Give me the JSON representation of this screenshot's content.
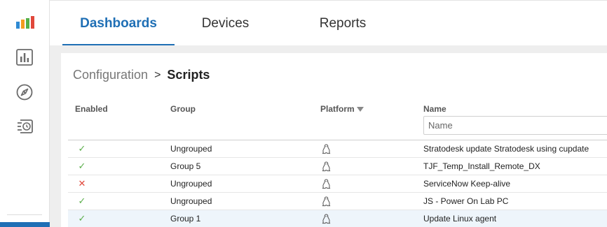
{
  "colors": {
    "accent": "#1f6fb5",
    "enabled_check": "#5aae4a",
    "disabled_x": "#e0483b",
    "logo_bars": [
      "#2f8ad3",
      "#f39c1f",
      "#55b048",
      "#e0483b"
    ]
  },
  "sidebar": {
    "icons": [
      "analytics-icon",
      "compass-icon",
      "scheduled-list-icon"
    ]
  },
  "tabs": [
    {
      "label": "Dashboards",
      "active": true
    },
    {
      "label": "Devices",
      "active": false
    },
    {
      "label": "Reports",
      "active": false
    }
  ],
  "breadcrumb": {
    "parent": "Configuration",
    "separator": ">",
    "current": "Scripts"
  },
  "table": {
    "headers": {
      "enabled": "Enabled",
      "group": "Group",
      "platform": "Platform",
      "name": "Name"
    },
    "name_filter_placeholder": "Name",
    "rows": [
      {
        "enabled": "✓",
        "enabled_state": "ok",
        "group": "Ungrouped",
        "platform": "linux-icon",
        "name": "Stratodesk update Stratodesk using cupdate"
      },
      {
        "enabled": "✓",
        "enabled_state": "ok",
        "group": "Group 5",
        "platform": "linux-icon",
        "name": "TJF_Temp_Install_Remote_DX"
      },
      {
        "enabled": "✕",
        "enabled_state": "fail",
        "group": "Ungrouped",
        "platform": "linux-icon",
        "name": "ServiceNow Keep-alive"
      },
      {
        "enabled": "✓",
        "enabled_state": "ok",
        "group": "Ungrouped",
        "platform": "linux-icon",
        "name": "JS - Power On Lab PC"
      },
      {
        "enabled": "✓",
        "enabled_state": "ok",
        "group": "Group 1",
        "platform": "linux-icon",
        "name": "Update Linux agent"
      }
    ]
  }
}
